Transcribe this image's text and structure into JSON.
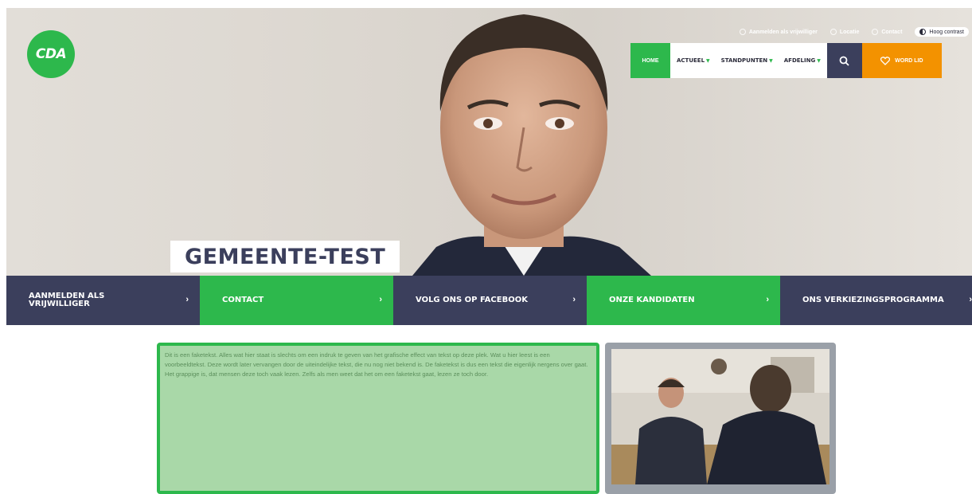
{
  "brand": {
    "logo_text": "CDA",
    "green": "#2db84c",
    "navy": "#3b3f5c",
    "orange": "#f39200"
  },
  "utility": {
    "volunteer": "Aanmelden als vrijwilliger",
    "location": "Locatie",
    "contact": "Contact",
    "contrast": "Hoog contrast"
  },
  "nav": {
    "home": "HOME",
    "actueel": "ACTUEEL",
    "standpunten": "STANDPUNTEN",
    "afdeling": "AFDELING",
    "word_lid": "WORD LID"
  },
  "hero": {
    "title": "GEMEENTE-TEST"
  },
  "tiles": [
    {
      "label": "AANMELDEN ALS VRIJWILLIGER",
      "arrow": "›"
    },
    {
      "label": "CONTACT",
      "arrow": "›"
    },
    {
      "label": "VOLG ONS OP FACEBOOK",
      "arrow": "›"
    },
    {
      "label": "ONZE KANDIDATEN",
      "arrow": "›"
    },
    {
      "label": "ONS VERKIEZINGSPROGRAMMA",
      "arrow": "›"
    }
  ],
  "content": {
    "paragraph": "Dit is een faketekst. Alles wat hier staat is slechts om een indruk te geven van het grafische effect van tekst op deze plek. Wat u hier leest is een voorbeeldtekst. Deze wordt later vervangen door de uiteindelijke tekst, die nu nog niet bekend is. De faketekst is dus een tekst die eigenlijk nergens over gaat. Het grappige is, dat mensen deze toch vaak lezen. Zelfs als men weet dat het om een faketekst gaat, lezen ze toch door."
  }
}
